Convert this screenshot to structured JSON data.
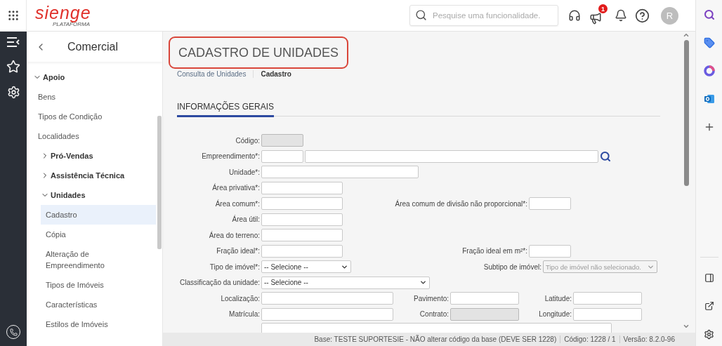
{
  "header": {
    "logo": {
      "name": "sienge",
      "tagline": "PLATAFORMA"
    },
    "search": {
      "placeholder": "Pesquise uma funcionalidade."
    },
    "notifications_badge": "1",
    "avatar": "R"
  },
  "sidebar": {
    "title": "Comercial",
    "items": [
      {
        "label": "Apoio",
        "expanded": true,
        "selected": false,
        "children": [
          {
            "label": "Bens",
            "selected": false
          },
          {
            "label": "Tipos de Condição",
            "selected": false
          },
          {
            "label": "Localidades",
            "selected": false
          },
          {
            "label": "Pró-Vendas",
            "expanded": false,
            "selected": false
          },
          {
            "label": "Assistência Técnica",
            "expanded": false,
            "selected": false
          },
          {
            "label": "Unidades",
            "expanded": true,
            "selected": false,
            "children": [
              {
                "label": "Cadastro",
                "selected": true
              },
              {
                "label": "Cópia",
                "selected": false
              },
              {
                "label": "Alteração de Empreendimento",
                "selected": false
              },
              {
                "label": "Tipos de Imóveis",
                "selected": false
              },
              {
                "label": "Características",
                "selected": false
              },
              {
                "label": "Estilos de Imóveis",
                "selected": false
              }
            ]
          }
        ]
      }
    ]
  },
  "page": {
    "title": "CADASTRO DE UNIDADES",
    "highlighted": true,
    "breadcrumb": [
      {
        "label": "Consulta de Unidades",
        "current": false
      },
      {
        "label": "Cadastro",
        "current": true
      }
    ],
    "section": "INFORMAÇÕES GERAIS"
  },
  "form": {
    "rows": [
      {
        "fields": [
          {
            "kind": "text",
            "label": "Código:",
            "disabled": true
          }
        ]
      },
      {
        "fields": [
          {
            "kind": "text",
            "label": "Empreendimento*:",
            "disabled": false
          },
          {
            "kind": "text",
            "disabled": false
          },
          {
            "kind": "lookup"
          }
        ]
      },
      {
        "fields": [
          {
            "kind": "text",
            "label": "Unidade*:",
            "disabled": false
          }
        ]
      },
      {
        "fields": [
          {
            "kind": "text",
            "label": "Área privativa*:",
            "disabled": false
          }
        ]
      },
      {
        "fields": [
          {
            "kind": "text",
            "label": "Área comum*:",
            "disabled": false
          },
          {
            "kind": "text",
            "label": "Área comum de divisão não proporcional*:",
            "disabled": false
          }
        ]
      },
      {
        "fields": [
          {
            "kind": "text",
            "label": "Área útil:",
            "disabled": false
          }
        ]
      },
      {
        "fields": [
          {
            "kind": "text",
            "label": "Área do terreno:",
            "disabled": false
          }
        ]
      },
      {
        "fields": [
          {
            "kind": "text",
            "label": "Fração ideal*:",
            "disabled": false
          },
          {
            "kind": "text",
            "label": "Fração ideal em m²*:",
            "disabled": false
          }
        ]
      },
      {
        "fields": [
          {
            "kind": "select",
            "label": "Tipo de imóvel*:",
            "value": "-- Selecione --",
            "disabled": false
          },
          {
            "kind": "select",
            "label": "Subtipo de imóvel:",
            "value": "Tipo de imóvel não selecionado.",
            "disabled": true
          }
        ]
      },
      {
        "fields": [
          {
            "kind": "select",
            "label": "Classificação da unidade:",
            "value": "-- Selecione --",
            "disabled": false
          }
        ]
      },
      {
        "fields": [
          {
            "kind": "text",
            "label": "Localização:",
            "disabled": false
          },
          {
            "kind": "text",
            "label": "Pavimento:",
            "disabled": false
          },
          {
            "kind": "text",
            "label": "Latitude:",
            "disabled": false
          }
        ]
      },
      {
        "fields": [
          {
            "kind": "text",
            "label": "Matrícula:",
            "disabled": false
          },
          {
            "kind": "text",
            "label": "Contrato:",
            "disabled": true
          },
          {
            "kind": "text",
            "label": "Longitude:",
            "disabled": false
          }
        ]
      },
      {
        "fields": [
          {
            "kind": "textarea",
            "disabled": false
          }
        ]
      }
    ]
  },
  "status_bar": [
    "Base: TESTE SUPORTESIE - NÃO alterar código da base (DEVE SER 1228)",
    "Código: 1228 / 1",
    "Versão: 8.2.0-96"
  ]
}
